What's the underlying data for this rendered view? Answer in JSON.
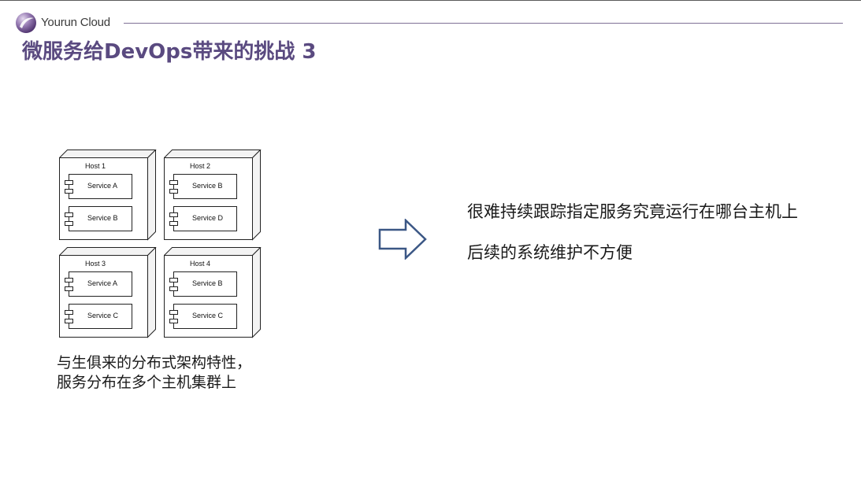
{
  "header": {
    "logo_icon": "yourun-cloud-logo-icon",
    "brand": "Yourun Cloud"
  },
  "slide": {
    "title": "微服务给DevOps带来的挑战 3"
  },
  "diagram": {
    "hosts": [
      {
        "label": "Host 1",
        "services": [
          "Service A",
          "Service B"
        ]
      },
      {
        "label": "Host 2",
        "services": [
          "Service B",
          "Service D"
        ]
      },
      {
        "label": "Host 3",
        "services": [
          "Service A",
          "Service C"
        ]
      },
      {
        "label": "Host 4",
        "services": [
          "Service B",
          "Service C"
        ]
      }
    ],
    "caption": [
      "与生俱来的分布式架构特性，",
      "服务分布在多个主机集群上"
    ]
  },
  "arrow": {
    "icon": "right-arrow-icon"
  },
  "points": [
    "很难持续跟踪指定服务究竟运行在哪台主机上",
    "后续的系统维护不方便"
  ],
  "colors": {
    "title": "#5a4a80",
    "rule": "#7f7196",
    "arrow": "#3b5785",
    "text": "#1a1a1a"
  }
}
